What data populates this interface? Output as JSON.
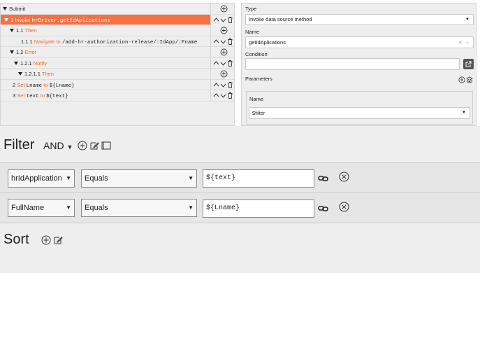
{
  "tree": {
    "root_label": "Submit",
    "rows": [
      {
        "num": "1",
        "keyword": "Invoke",
        "target": "hrDriver.getIdAplications"
      },
      {
        "num": "1.1",
        "keyword": "Then"
      },
      {
        "num": "1.1.1",
        "keyword": "Navigate to",
        "target": "/add-hr-authorization-release/:IdApp/:Fname"
      },
      {
        "num": "1.2",
        "keyword": "Error"
      },
      {
        "num": "1.2.1",
        "keyword": "Notify"
      },
      {
        "num": "1.2.1.1",
        "keyword": "Then"
      },
      {
        "num": "2",
        "keyword": "Set",
        "target": "Lname",
        "to": "to",
        "value": "${Lname}"
      },
      {
        "num": "3",
        "keyword": "Set",
        "target": "text",
        "to": "to",
        "value": "${text}"
      }
    ]
  },
  "props": {
    "type_label": "Type",
    "type_value": "Invoke data source method",
    "name_label": "Name",
    "name_value": "getIdAplications",
    "condition_label": "Condition",
    "condition_value": "",
    "parameters_label": "Parameters",
    "param_name_label": "Name",
    "param_name_value": "$filter"
  },
  "filter": {
    "title": "Filter",
    "operator": "AND",
    "rows": [
      {
        "field": "hrIdApplication",
        "op": "Equals",
        "value": "${text}"
      },
      {
        "field": "FullName",
        "op": "Equals",
        "value": "${Lname}"
      }
    ]
  },
  "sort": {
    "title": "Sort"
  },
  "colors": {
    "accent": "#f47142",
    "keyword": "#ee6a2c",
    "panel": "#eeeeee"
  },
  "icons": [
    "plus-circle-icon",
    "edit-icon",
    "copy-icon",
    "chevron-up-icon",
    "chevron-down-icon",
    "trash-icon",
    "link-icon",
    "remove-circle-icon",
    "clear-x-icon",
    "external-link-icon"
  ]
}
